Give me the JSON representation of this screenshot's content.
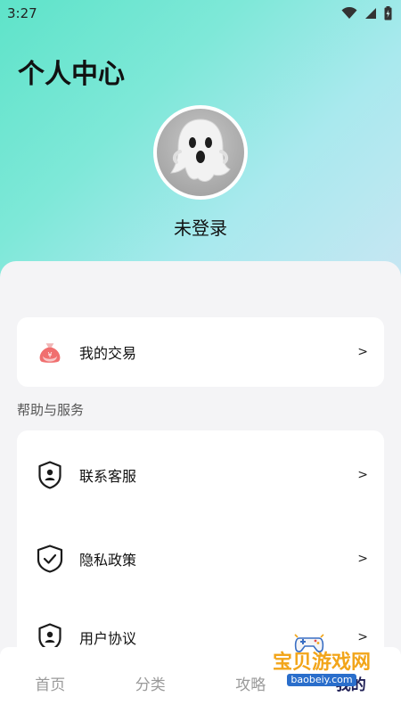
{
  "status_bar": {
    "time": "3:27"
  },
  "page_title": "个人中心",
  "login_status": "未登录",
  "trade_card": {
    "label": "我的交易",
    "arrow": ">"
  },
  "help_section": {
    "title": "帮助与服务",
    "items": [
      {
        "label": "联系客服",
        "icon": "person-shield-icon",
        "arrow": ">"
      },
      {
        "label": "隐私政策",
        "icon": "check-shield-icon",
        "arrow": ">"
      },
      {
        "label": "用户协议",
        "icon": "person-shield-icon",
        "arrow": ">"
      }
    ]
  },
  "tabbar": {
    "tabs": [
      {
        "label": "首页",
        "active": false
      },
      {
        "label": "分类",
        "active": false
      },
      {
        "label": "攻略",
        "active": false
      },
      {
        "label": "我的",
        "active": true
      }
    ]
  },
  "watermark": {
    "text": "宝贝游戏网",
    "url": "baobeiy.com"
  },
  "colors": {
    "accent": "#5ee3c9",
    "active_tab": "#1f1f55",
    "watermark": "#f2a51a"
  }
}
